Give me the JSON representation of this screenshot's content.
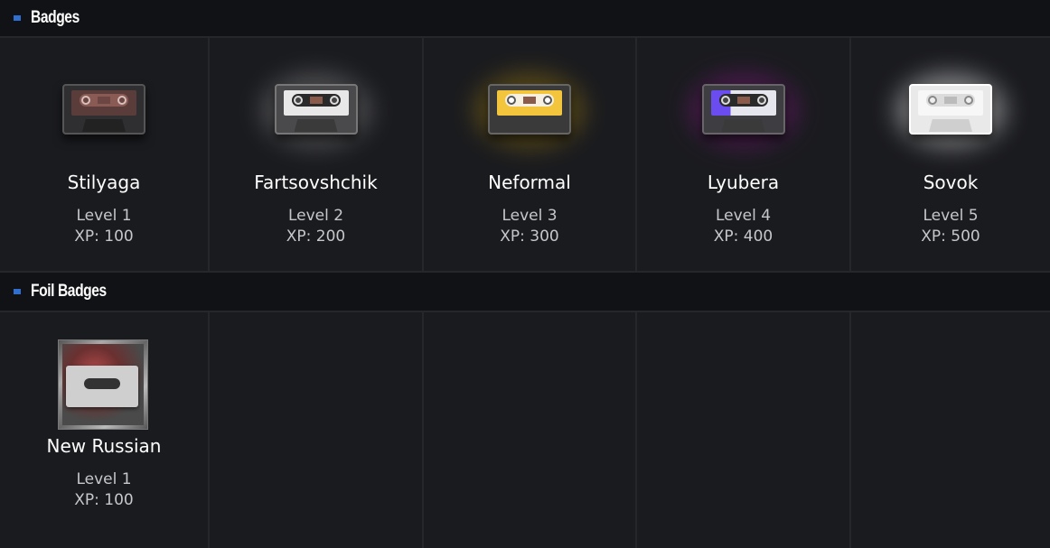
{
  "sections": [
    {
      "title": "Badges",
      "badges": [
        {
          "name": "Stilyaga",
          "level": "Level 1",
          "xp": "XP: 100",
          "icon": "cassette-dark-icon",
          "accent": "#8a5a55"
        },
        {
          "name": "Fartsovshchik",
          "level": "Level 2",
          "xp": "XP: 200",
          "icon": "cassette-grey-icon",
          "accent": "#e0e0e0"
        },
        {
          "name": "Neformal",
          "level": "Level 3",
          "xp": "XP: 300",
          "icon": "cassette-yellow-icon",
          "accent": "#f2c53d"
        },
        {
          "name": "Lyubera",
          "level": "Level 4",
          "xp": "XP: 400",
          "icon": "cassette-purple-icon",
          "accent": "#6b4cf0"
        },
        {
          "name": "Sovok",
          "level": "Level 5",
          "xp": "XP: 500",
          "icon": "cassette-white-icon",
          "accent": "#f5f5f5"
        }
      ]
    },
    {
      "title": "Foil Badges",
      "badges": [
        {
          "name": "New Russian",
          "level": "Level 1",
          "xp": "XP: 100",
          "icon": "cassette-foil-icon",
          "accent": "#b34a4a"
        }
      ]
    }
  ]
}
